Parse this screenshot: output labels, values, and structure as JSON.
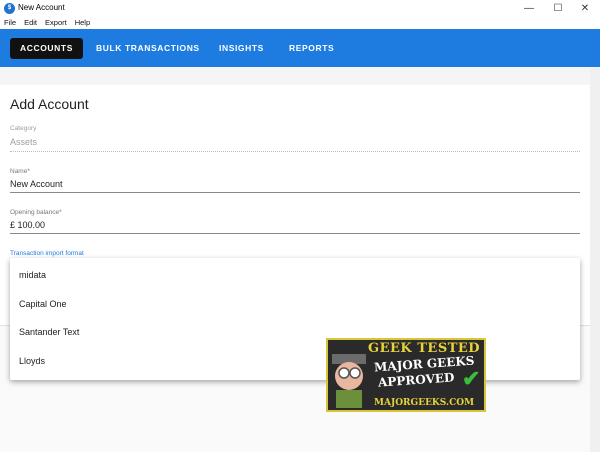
{
  "window": {
    "title": "New Account",
    "app_icon": "app-icon",
    "controls": {
      "minimize": "—",
      "maximize": "☐",
      "close": "✕"
    }
  },
  "menu": [
    "File",
    "Edit",
    "Export",
    "Help"
  ],
  "nav": {
    "tabs": [
      {
        "label": "ACCOUNTS",
        "active": true
      },
      {
        "label": "BULK TRANSACTIONS",
        "active": false
      },
      {
        "label": "INSIGHTS",
        "active": false
      },
      {
        "label": "REPORTS",
        "active": false
      }
    ]
  },
  "form": {
    "title": "Add Account",
    "category": {
      "label": "Category",
      "value": "Assets"
    },
    "name": {
      "label": "Name*",
      "value": "New Account"
    },
    "opening_balance": {
      "label": "Opening balance*",
      "value": "£ 100.00"
    },
    "import_format": {
      "label": "Transaction import format"
    }
  },
  "dropdown": {
    "options": [
      "midata",
      "Capital One",
      "Santander Text",
      "Lloyds"
    ]
  },
  "badge": {
    "line1": "GEEK TESTED",
    "line2": "MAJOR GEEKS",
    "line3": "APPROVED",
    "line4": "MAJORGEEKS.COM"
  },
  "colors": {
    "appbar": "#1e7be0",
    "active_tab": "#111111",
    "focus_label": "#1e7be0"
  }
}
